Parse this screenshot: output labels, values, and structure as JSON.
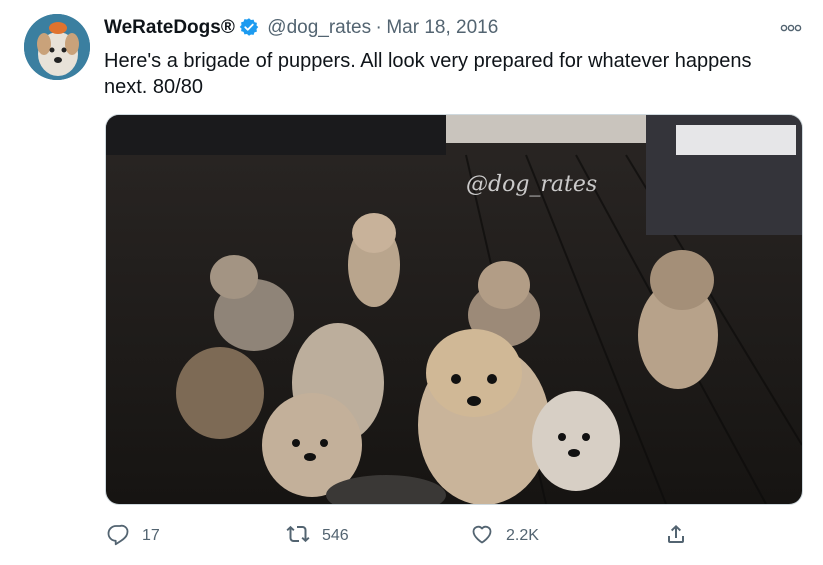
{
  "tweet": {
    "author_name": "WeRateDogs®",
    "handle": "@dog_rates",
    "separator": "·",
    "date": "Mar 18, 2016",
    "text": "Here's a brigade of puppers. All look very prepared for whatever happens next. 80/80",
    "media": {
      "watermark": "@dog_rates"
    },
    "actions": {
      "reply_count": "17",
      "retweet_count": "546",
      "like_count": "2.2K"
    }
  },
  "icons": {
    "verified": "verified-badge-icon",
    "more": "more-options-icon",
    "reply": "reply-icon",
    "retweet": "retweet-icon",
    "like": "heart-icon",
    "share": "share-icon"
  },
  "colors": {
    "verified_blue": "#1d9bf0",
    "muted_text": "#536471",
    "main_text": "#0f1419"
  }
}
